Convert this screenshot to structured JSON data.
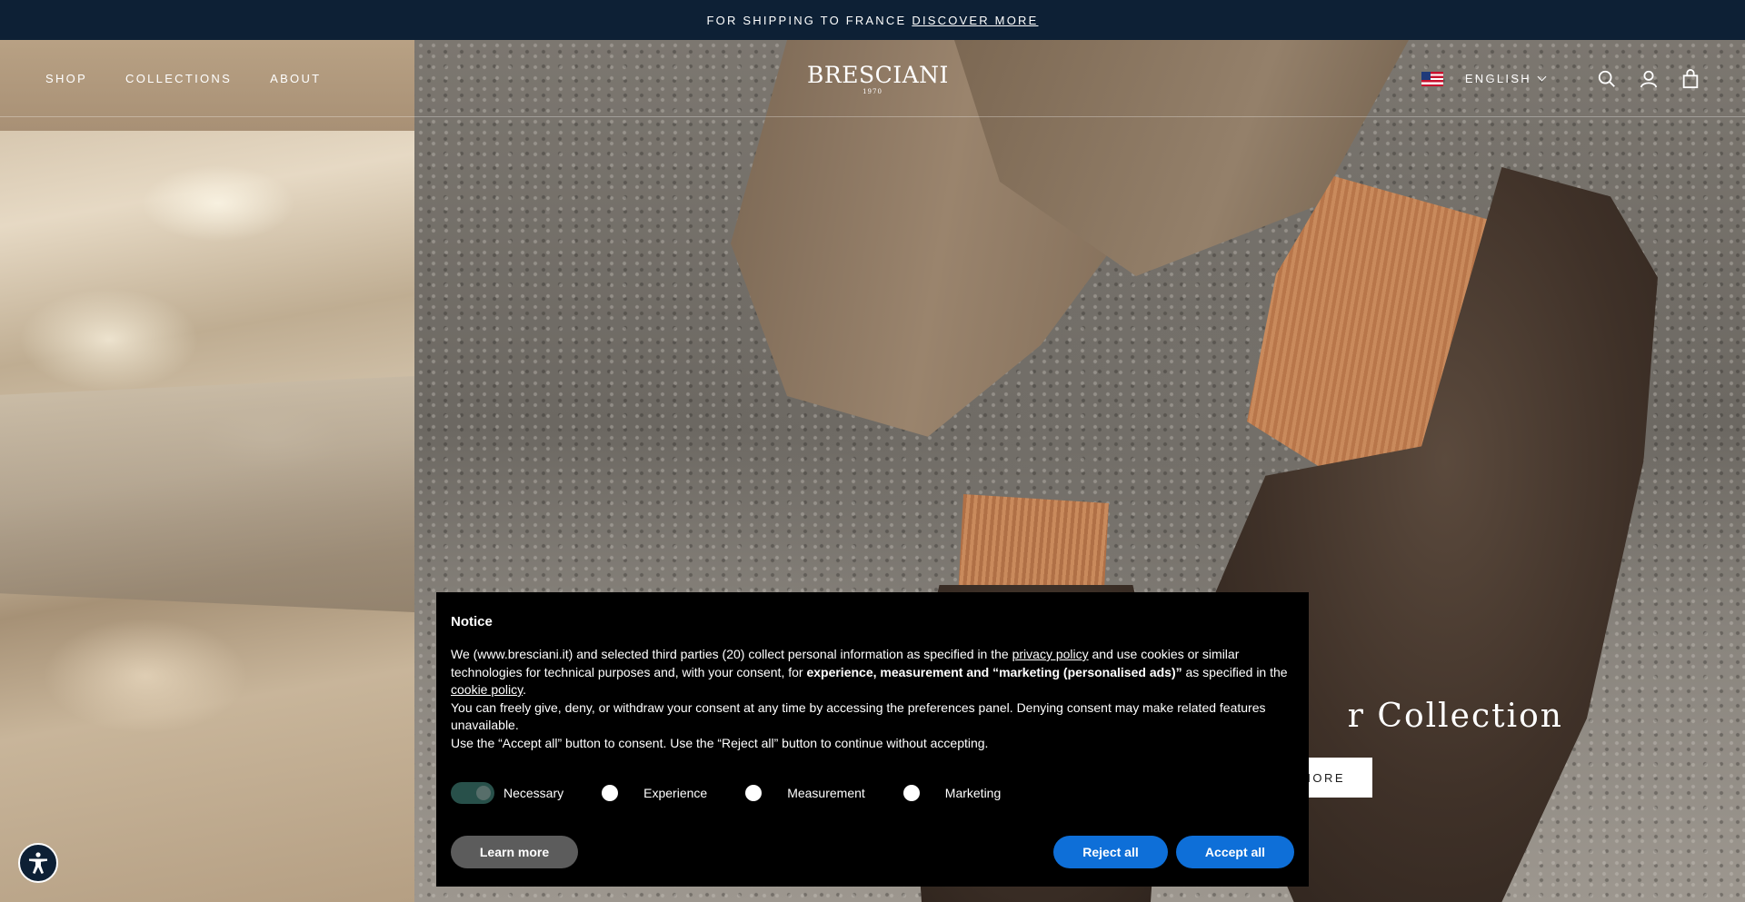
{
  "announcement": {
    "text": "FOR SHIPPING TO FRANCE",
    "link": "DISCOVER MORE"
  },
  "nav": {
    "items": [
      {
        "label": "SHOP"
      },
      {
        "label": "COLLECTIONS"
      },
      {
        "label": "ABOUT"
      }
    ]
  },
  "logo": {
    "name": "BRESCIANI",
    "year": "1970"
  },
  "header_right": {
    "flag": "us-flag-icon",
    "language": "ENGLISH",
    "icons": [
      "search-icon",
      "account-icon",
      "cart-icon"
    ]
  },
  "hero": {
    "title": "r Collection",
    "button": "MORE"
  },
  "cookie": {
    "title": "Notice",
    "p1_a": "We (www.bresciani.it) and selected third parties (20) collect personal information as specified in the ",
    "p1_link1": "privacy policy",
    "p1_b": " and use cookies or similar technologies for technical purposes and, with your consent, for ",
    "p1_bold": "experience, measurement and “marketing (personalised ads)”",
    "p1_c": " as specified in the ",
    "p1_link2": "cookie policy",
    "p1_d": ".",
    "p2": "You can freely give, deny, or withdraw your consent at any time by accessing the preferences panel. Denying consent may make related features unavailable.",
    "p3": "Use the “Accept all” button to consent. Use the “Reject all” button to continue without accepting.",
    "toggles": [
      {
        "label": "Necessary",
        "checked": true
      },
      {
        "label": "Experience",
        "checked": false
      },
      {
        "label": "Measurement",
        "checked": false
      },
      {
        "label": "Marketing",
        "checked": false
      }
    ],
    "learn_more": "Learn more",
    "reject_all": "Reject all",
    "accept_all": "Accept all"
  },
  "colors": {
    "announce_bg": "#0d2035",
    "button_blue": "#0e6fd8",
    "banner_bg": "#000000"
  }
}
